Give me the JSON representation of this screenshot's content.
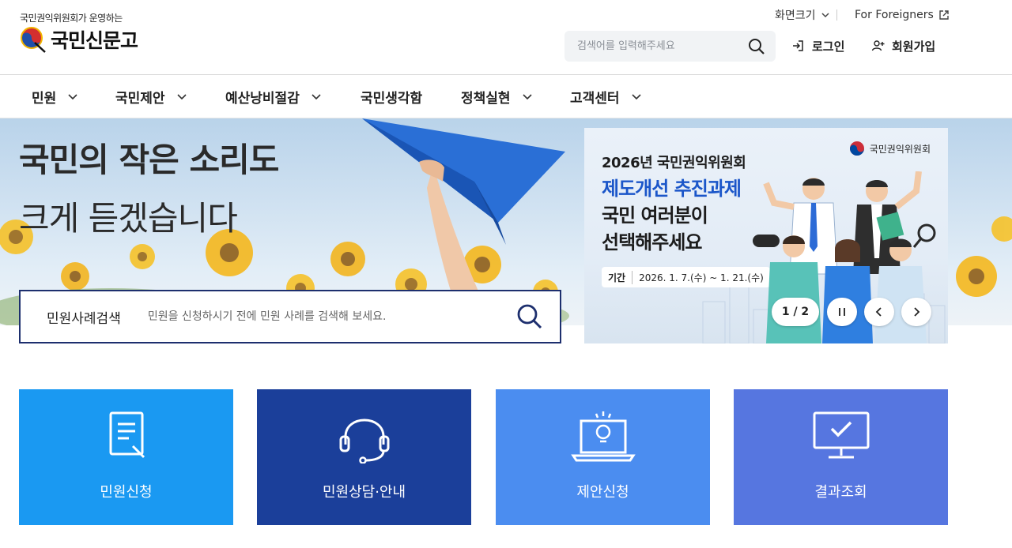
{
  "header": {
    "logo_sub": "국민권익위원회가 운영하는",
    "logo_text": "국민신문고",
    "font_size_label": "화면크기",
    "foreigners_label": "For Foreigners",
    "search_placeholder": "검색어를 입력해주세요",
    "login_label": "로그인",
    "join_label": "회원가입"
  },
  "nav": {
    "items": [
      {
        "label": "민원"
      },
      {
        "label": "국민제안"
      },
      {
        "label": "예산낭비절감"
      },
      {
        "label": "국민생각함"
      },
      {
        "label": "정책실현"
      },
      {
        "label": "고객센터"
      }
    ]
  },
  "hero": {
    "title_line1": "국민의 작은 소리도",
    "title_line2": "크게 듣겠습니다"
  },
  "case_search": {
    "label": "민원사례검색",
    "placeholder": "민원을 신청하시기 전에 민원 사례를 검색해 보세요."
  },
  "banner": {
    "org": "국민권익위원회",
    "year_title": "2026년 국민권익위원회",
    "headline_line1": "제도개선 추진과제",
    "headline_line2": "국민 여러분이",
    "headline_line3": "선택해주세요",
    "period_label": "기간",
    "period_value": "2026. 1. 7.(수) ~ 1. 21.(수)",
    "pagination": "1 / 2"
  },
  "quick_menu": [
    {
      "label": "민원신청",
      "icon": "document-edit-icon",
      "color": "#1a99f2"
    },
    {
      "label": "민원상담·안내",
      "icon": "headset-icon",
      "color": "#1b3f9a"
    },
    {
      "label": "제안신청",
      "icon": "lightbulb-laptop-icon",
      "color": "#4b8df0"
    },
    {
      "label": "결과조회",
      "icon": "monitor-check-icon",
      "color": "#5676e0"
    }
  ],
  "colors": {
    "nav_text": "#222222",
    "case_search_border": "#1d2f6e",
    "banner_blue": "#1b56c9"
  }
}
